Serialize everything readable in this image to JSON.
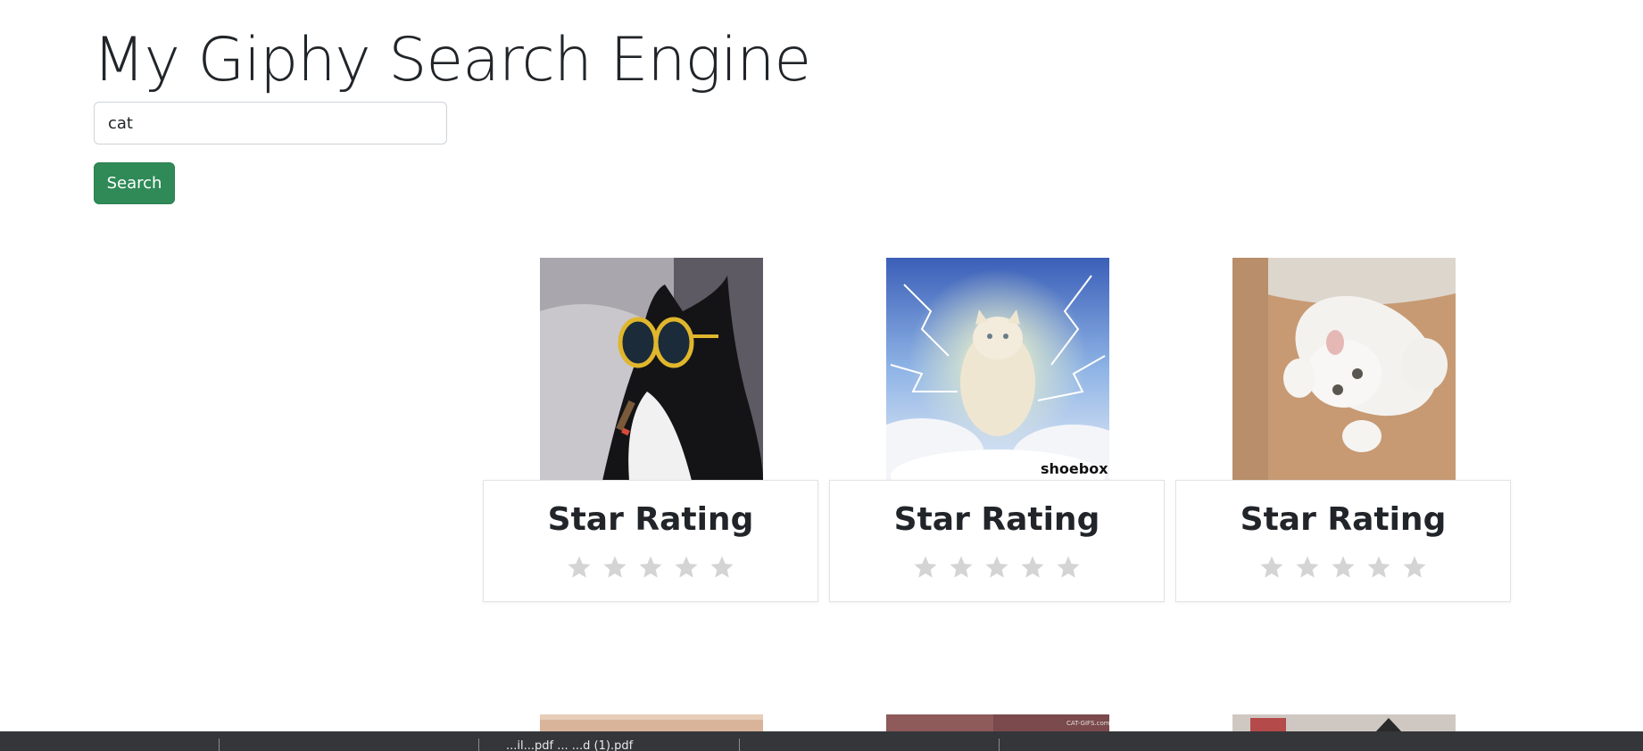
{
  "page": {
    "title": "My Giphy Search Engine"
  },
  "search": {
    "value": "cat",
    "button_label": "Search"
  },
  "results": [
    {
      "rating_title": "Star Rating",
      "stars_total": 5,
      "stars_filled": 0,
      "watermark": ""
    },
    {
      "rating_title": "Star Rating",
      "stars_total": 5,
      "stars_filled": 0,
      "watermark": "shoebox"
    },
    {
      "rating_title": "Star Rating",
      "stars_total": 5,
      "stars_filled": 0,
      "watermark": ""
    }
  ],
  "partial_results": [
    {
      "watermark": ""
    },
    {
      "watermark": "CAT-GIFS.com"
    },
    {
      "watermark": ""
    }
  ],
  "taskbar": {
    "item_text": "...il...pdf ... ...d (1).pdf"
  },
  "colors": {
    "button": "#2f8a57",
    "star_empty": "#d4d4d4",
    "taskbar": "#35363a"
  }
}
